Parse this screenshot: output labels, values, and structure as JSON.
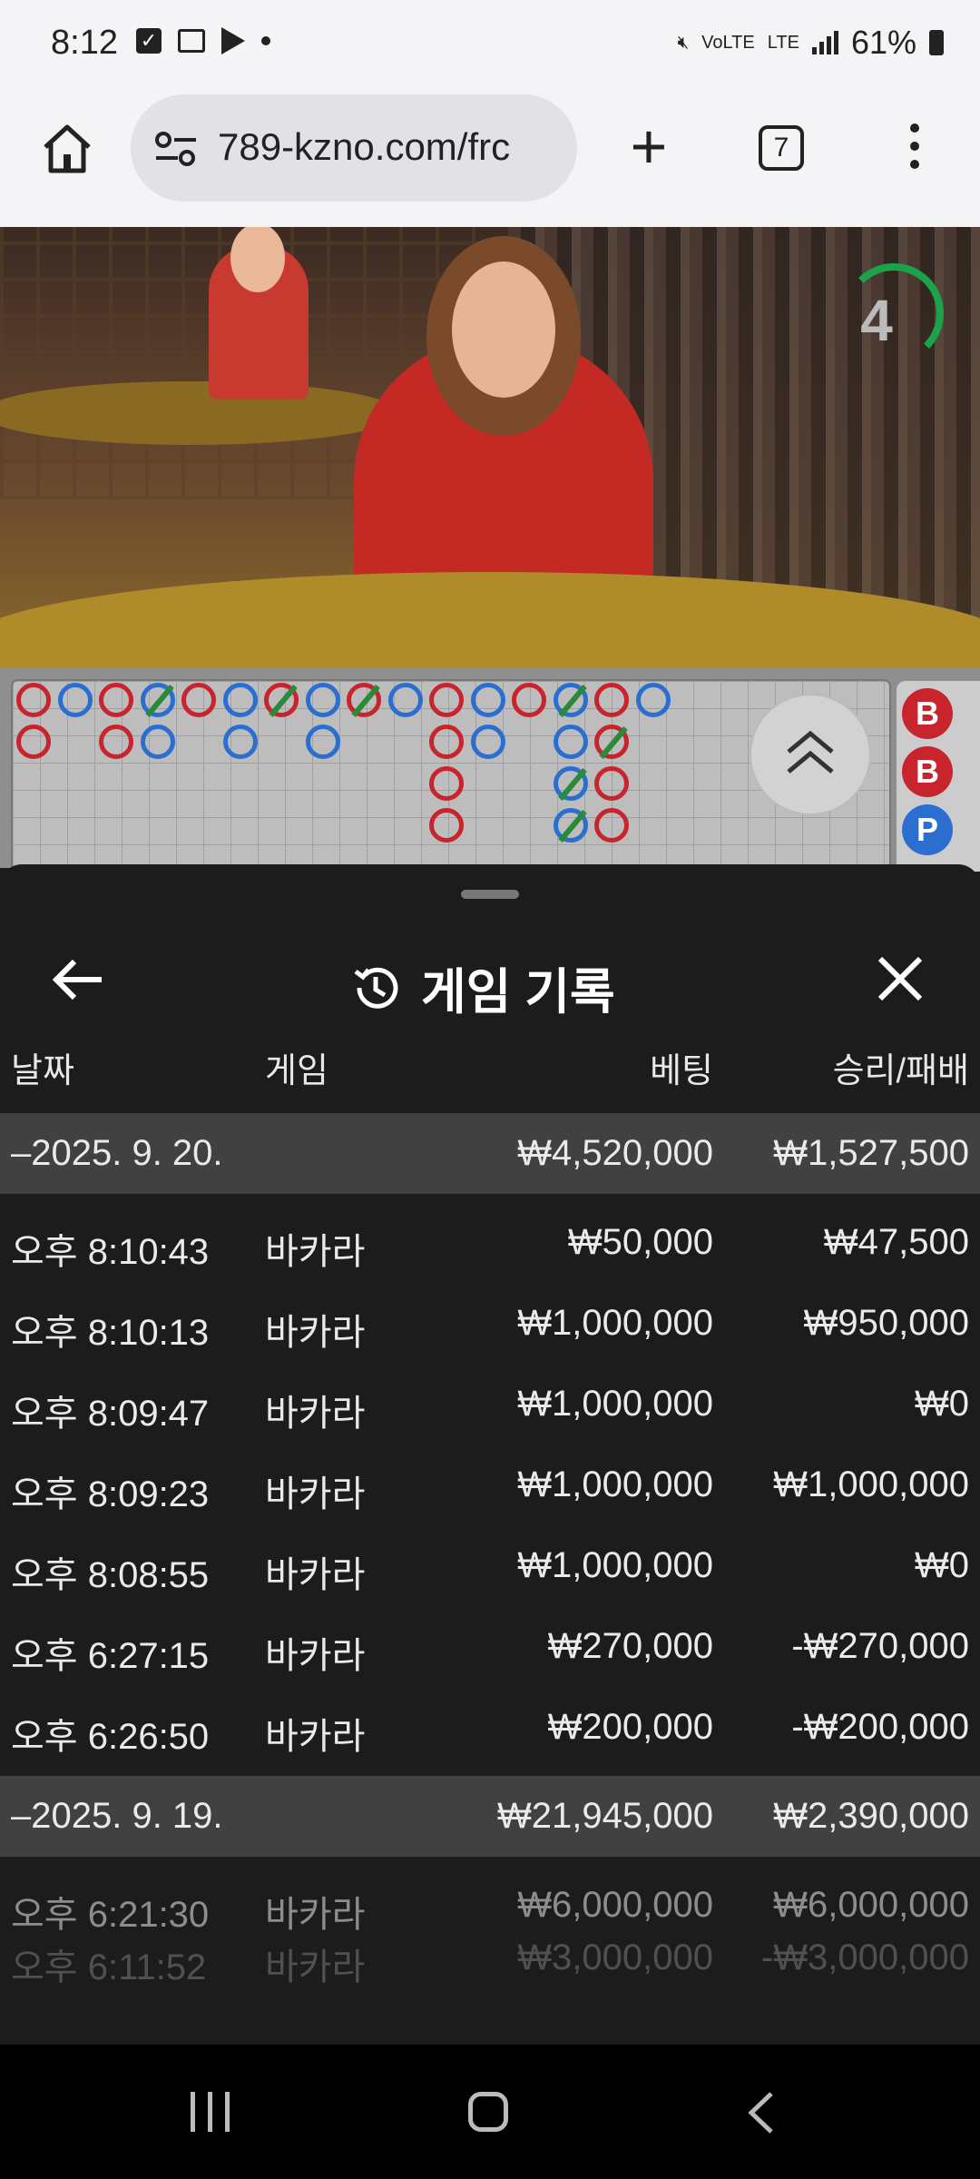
{
  "status_bar": {
    "time": "8:12",
    "battery": "61%",
    "network": "LTE"
  },
  "browser": {
    "url": "789-kzno.com/frc",
    "tab_count": "7"
  },
  "video": {
    "countdown": "4"
  },
  "side_predictions": [
    "B",
    "B",
    "P"
  ],
  "sheet": {
    "title": "게임 기록",
    "columns": {
      "date": "날짜",
      "game": "게임",
      "bet": "베팅",
      "win_loss": "승리/패배"
    },
    "groups": [
      {
        "date": "–2025. 9. 20.",
        "bet_total": "₩4,520,000",
        "wl_total": "₩1,527,500",
        "rows": [
          {
            "time": "오후 8:10:43",
            "game": "바카라",
            "bet": "₩50,000",
            "wl": "₩47,500"
          },
          {
            "time": "오후 8:10:13",
            "game": "바카라",
            "bet": "₩1,000,000",
            "wl": "₩950,000"
          },
          {
            "time": "오후 8:09:47",
            "game": "바카라",
            "bet": "₩1,000,000",
            "wl": "₩0"
          },
          {
            "time": "오후 8:09:23",
            "game": "바카라",
            "bet": "₩1,000,000",
            "wl": "₩1,000,000"
          },
          {
            "time": "오후 8:08:55",
            "game": "바카라",
            "bet": "₩1,000,000",
            "wl": "₩0"
          },
          {
            "time": "오후 6:27:15",
            "game": "바카라",
            "bet": "₩270,000",
            "wl": "-₩270,000"
          },
          {
            "time": "오후 6:26:50",
            "game": "바카라",
            "bet": "₩200,000",
            "wl": "-₩200,000"
          }
        ]
      },
      {
        "date": "–2025. 9. 19.",
        "bet_total": "₩21,945,000",
        "wl_total": "₩2,390,000",
        "rows": [
          {
            "time": "오후 6:21:30",
            "game": "바카라",
            "bet": "₩6,000,000",
            "wl": "₩6,000,000"
          },
          {
            "time": "오후 6:11:52",
            "game": "바카라",
            "bet": "₩3,000,000",
            "wl": "-₩3,000,000"
          }
        ]
      }
    ]
  }
}
